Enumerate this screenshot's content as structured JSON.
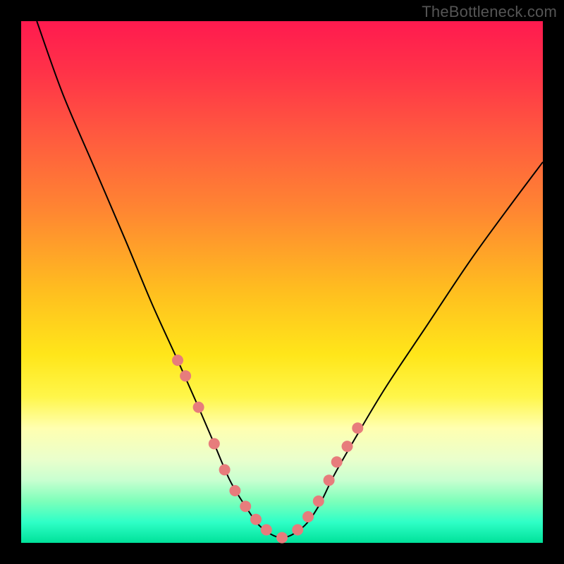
{
  "watermark": "TheBottleneck.com",
  "colors": {
    "gradient_top": "#ff1a4f",
    "gradient_bottom": "#00e29a",
    "curve": "#000000",
    "marker": "#e77c7c",
    "frame": "#000000"
  },
  "chart_data": {
    "type": "line",
    "title": "",
    "xlabel": "",
    "ylabel": "",
    "xlim": [
      0,
      100
    ],
    "ylim": [
      0,
      100
    ],
    "grid": false,
    "legend": false,
    "series": [
      {
        "name": "bottleneck-curve",
        "x": [
          3,
          8,
          14,
          20,
          25,
          30,
          34,
          37,
          40,
          43,
          46,
          50,
          54,
          57,
          60,
          64,
          70,
          78,
          86,
          94,
          100
        ],
        "y": [
          100,
          86,
          72,
          58,
          46,
          35,
          26,
          19,
          12,
          7,
          3,
          1,
          3,
          7,
          13,
          20,
          30,
          42,
          54,
          65,
          73
        ]
      }
    ],
    "markers": {
      "name": "highlighted-points",
      "x": [
        30,
        31.5,
        34,
        37,
        39,
        41,
        43,
        45,
        47,
        50,
        53,
        55,
        57,
        59,
        60.5,
        62.5,
        64.5
      ],
      "y": [
        35,
        32,
        26,
        19,
        14,
        10,
        7,
        4.5,
        2.5,
        1,
        2.5,
        5,
        8,
        12,
        15.5,
        18.5,
        22
      ]
    }
  }
}
